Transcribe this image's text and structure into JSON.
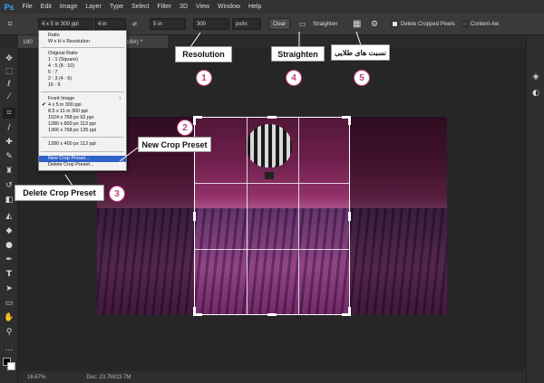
{
  "app": {
    "logo": "Ps"
  },
  "menu": [
    "File",
    "Edit",
    "Image",
    "Layer",
    "Type",
    "Select",
    "Filter",
    "3D",
    "View",
    "Window",
    "Help"
  ],
  "options": {
    "preset_value": "4 x 5 in 300 ppi",
    "width_value": "4 in",
    "height_value": "5 in",
    "resolution_value": "300",
    "unit_value": "px/in",
    "clear_label": "Clear",
    "straighten_label": "Straighten",
    "delete_cropped_label": "Delete Cropped Pixels",
    "content_aware_label": "Content-Aw"
  },
  "tab": {
    "left_label": "180",
    "right_label": ", RGB/8#) *"
  },
  "status": {
    "zoom": "16.67%",
    "doc": "Doc: 23.7M/23.7M"
  },
  "dropdown": {
    "items": [
      "Ratio",
      "W x H x Resolution",
      "Original Ratio",
      "1 : 1 (Square)",
      "4 : 5 (8 : 10)",
      "5 : 7",
      "2 : 3 (4 : 6)",
      "16 : 9",
      "Front Image",
      "4 x 5 in 300 ppi",
      "8.5 x 11 in 300 ppi",
      "1024 x 768 px 92 ppi",
      "1280 x 800 px 113 ppi",
      "1366 x 768 px 135 ppi",
      "1280 x 400 px 113 ppi",
      "New Crop Preset...",
      "Delete Crop Preset..."
    ]
  },
  "annotations": {
    "resolution": "Resolution",
    "straighten": "Straighten",
    "golden": "نسبت های طلایی",
    "new_preset": "New Crop Preset",
    "delete_preset": "Delete Crop Preset",
    "n1": "1",
    "n2": "2",
    "n3": "3",
    "n4": "4",
    "n5": "5"
  },
  "icons": [
    "crop-tool-icon",
    "move-icon",
    "marquee-icon",
    "lasso-icon",
    "magic-wand-icon",
    "eyedropper-icon",
    "brush-icon",
    "text-icon",
    "hand-icon",
    "zoom-icon",
    "grid-overlay-icon",
    "gear-icon",
    "checkmark-icon"
  ],
  "colors": {
    "accent": "#c0407a",
    "menu_highlight": "#2f62c9",
    "ps_blue": "#31a8ff"
  }
}
